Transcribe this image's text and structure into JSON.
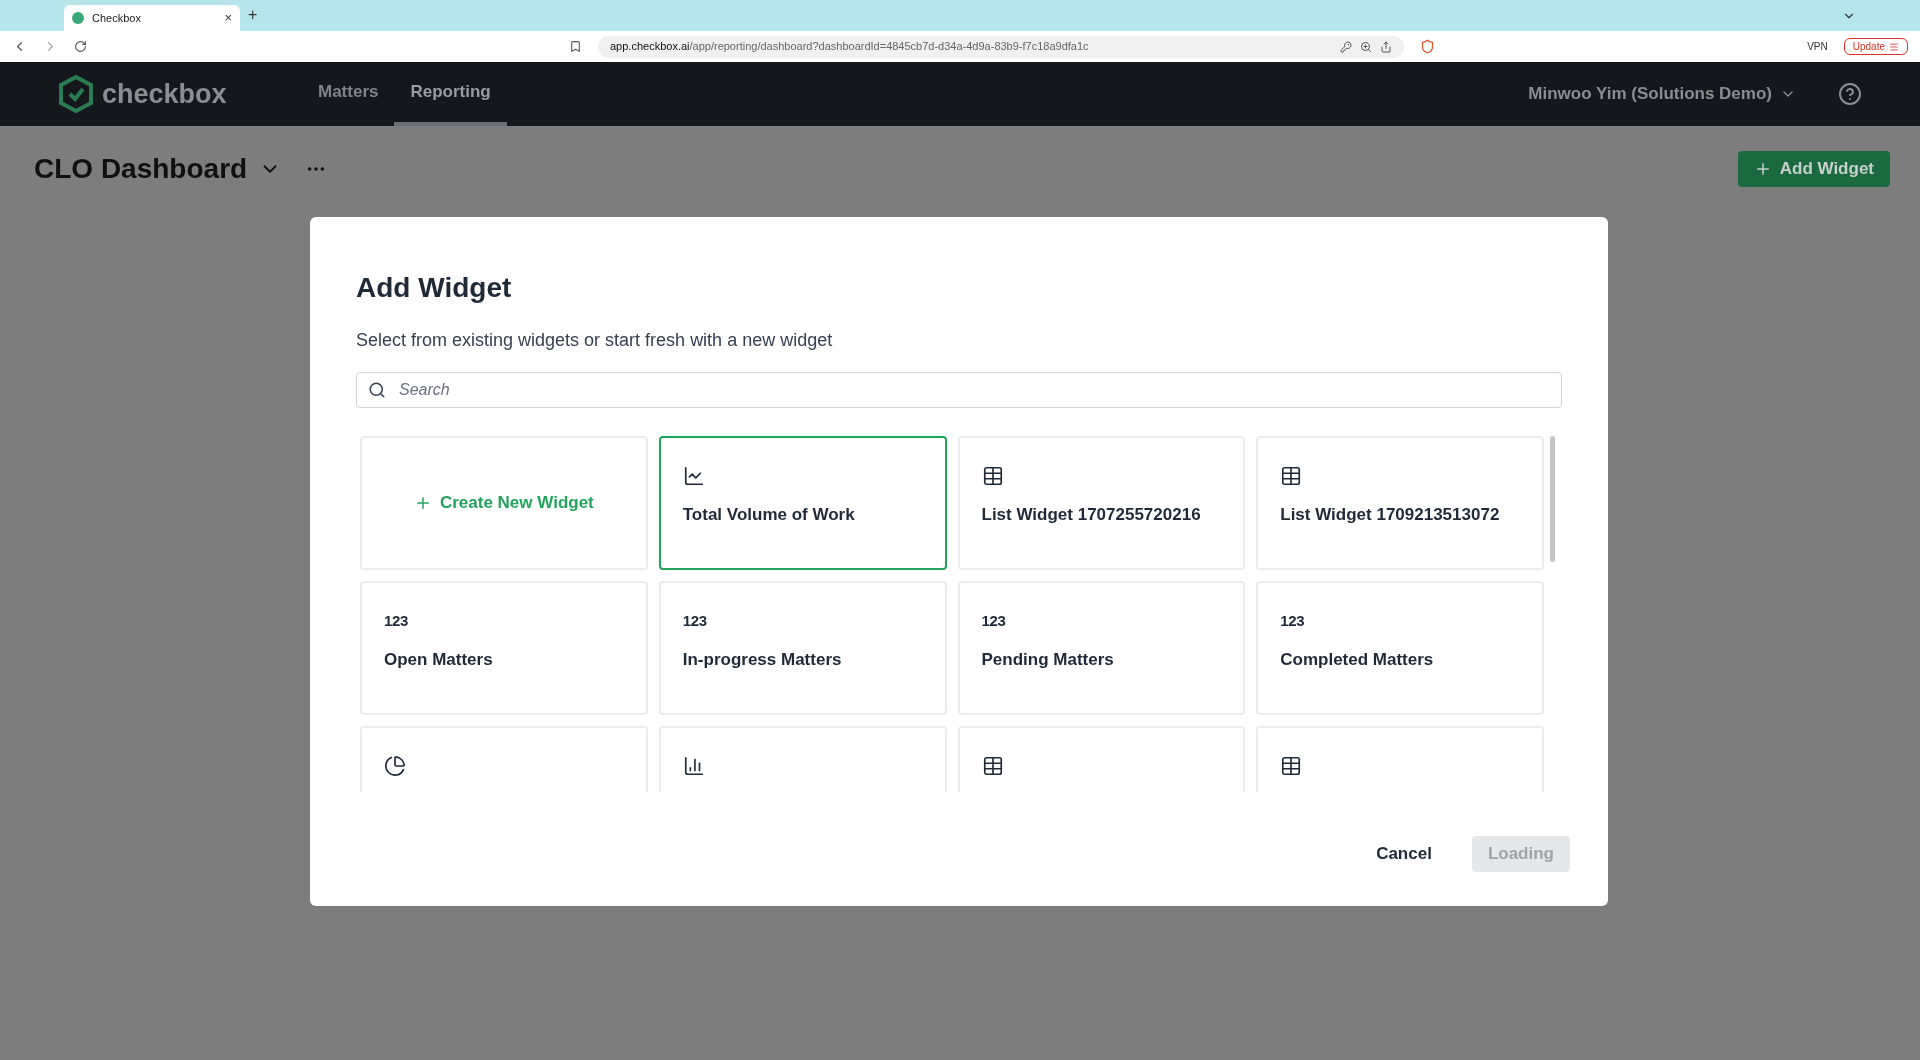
{
  "browser": {
    "tab_title": "Checkbox",
    "tab_close": "×",
    "new_tab": "+",
    "url_domain": "app.checkbox.ai",
    "url_path": "/app/reporting/dashboard?dashboardId=4845cb7d-d34a-4d9a-83b9-f7c18a9dfa1c",
    "vpn": "VPN",
    "update": "Update"
  },
  "header": {
    "logo": "checkbox",
    "nav": [
      {
        "label": "Matters",
        "selected": false
      },
      {
        "label": "Reporting",
        "selected": true
      }
    ],
    "user": "Minwoo Yim (Solutions Demo)"
  },
  "page": {
    "title": "CLO Dashboard",
    "add_button": "Add Widget"
  },
  "dialog": {
    "title": "Add Widget",
    "subtitle": "Select from existing widgets or start fresh with a new widget",
    "search": {
      "placeholder": "Search"
    },
    "cards": [
      {
        "kind": "create",
        "title": "Create New Widget",
        "selected": false
      },
      {
        "kind": "line",
        "title": "Total Volume of Work",
        "selected": true
      },
      {
        "kind": "table",
        "title": "List Widget 1707255720216",
        "selected": false
      },
      {
        "kind": "table",
        "title": "List Widget 1709213513072",
        "selected": false
      },
      {
        "kind": "number",
        "glyph": "123",
        "title": "Open Matters",
        "selected": false
      },
      {
        "kind": "number",
        "glyph": "123",
        "title": "In-progress Matters",
        "selected": false
      },
      {
        "kind": "number",
        "glyph": "123",
        "title": "Pending Matters",
        "selected": false
      },
      {
        "kind": "number",
        "glyph": "123",
        "title": "Completed Matters",
        "selected": false
      },
      {
        "kind": "pie",
        "selected": false
      },
      {
        "kind": "bar",
        "selected": false
      },
      {
        "kind": "table",
        "selected": false
      },
      {
        "kind": "table",
        "selected": false
      }
    ],
    "cancel": "Cancel",
    "confirm": {
      "label": "Loading",
      "disabled": true
    }
  }
}
